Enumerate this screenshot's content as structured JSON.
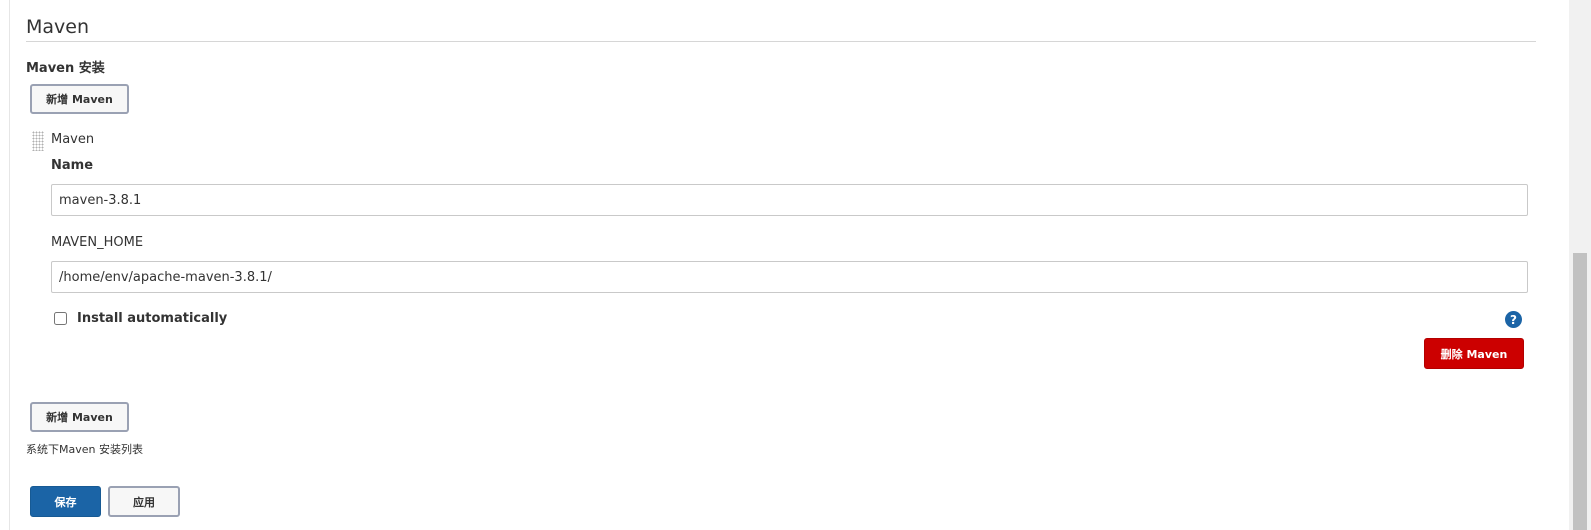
{
  "section": {
    "title": "Maven"
  },
  "maven_installations": {
    "caption": "Maven 安装",
    "add_button_top_label": "新增 Maven",
    "installer": {
      "title": "Maven",
      "name_label": "Name",
      "name_value": "maven-3.8.1",
      "home_label": "MAVEN_HOME",
      "home_value": "/home/env/apache-maven-3.8.1/",
      "install_auto_label": "Install automatically",
      "install_auto_checked": false,
      "help_icon": "?",
      "delete_button_label": "删除 Maven"
    },
    "add_button_bottom_label": "新增 Maven",
    "description": "系统下Maven 安装列表"
  },
  "form_actions": {
    "save_label": "保存",
    "apply_label": "应用"
  },
  "colors": {
    "primary": "#1b64a6",
    "danger": "#cc0000"
  }
}
